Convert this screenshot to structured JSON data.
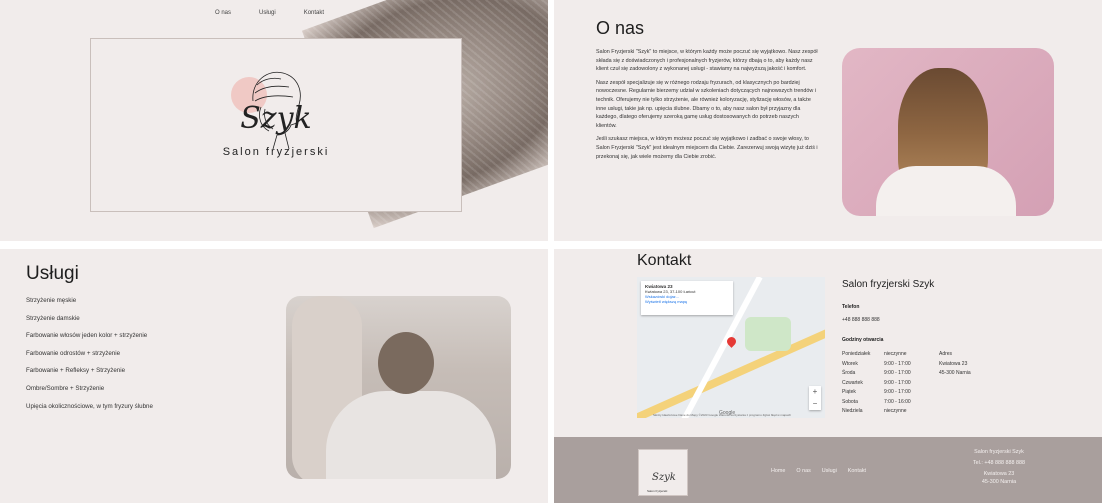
{
  "nav": {
    "items": [
      "O nas",
      "Usługi",
      "Kontakt"
    ]
  },
  "logo": {
    "word": "Szyk",
    "subtitle": "Salon fryzjerski"
  },
  "about": {
    "title": "O nas",
    "paragraphs": [
      "Salon Fryzjerski \"Szyk\" to miejsce, w którym każdy może poczuć się wyjątkowo. Nasz zespół składa się z doświadczonych i profesjonalnych fryzjerów, którzy dbają o to, aby każdy nasz klient czuł się zadowolony z wykonanej usługi - stawiamy na najwyższą jakość i komfort.",
      "Nasz zespół specjalizuje się w różnego rodzaju fryzurach, od klasycznych po bardziej nowoczesne. Regularnie bierzemy udział w szkoleniach dotyczących najnowszych trendów i technik. Oferujemy nie tylko strzyżenie, ale również koloryzację, stylizację włosów, a także inne usługi, takie jak np. upięcia ślubne. Dbamy o to, aby nasz salon był przyjazny dla każdego, dlatego oferujemy szeroką gamę usług dostosowanych do potrzeb naszych klientów.",
      "Jeśli szukasz miejsca, w którym możesz poczuć się wyjątkowo i zadbać o swoje włosy, to Salon Fryzjerski \"Szyk\" jest idealnym miejscem dla Ciebie. Zarezerwuj swoją wizytę już dziś i przekonaj się, jak wiele możemy dla Ciebie zrobić."
    ]
  },
  "services": {
    "title": "Usługi",
    "items": [
      "Strzyżenie męskie",
      "Strzyżenie damskie",
      "Farbowanie włosów jeden kolor + strzyżenie",
      "Farbowanie odrostów + strzyżenie",
      "Farbowanie + Refleksy + Strzyżenie",
      "Ombre/Sombre + Strzyżenie",
      "Upięcia okolicznościowe, w tym fryzury ślubne"
    ]
  },
  "contact": {
    "title": "Kontakt",
    "map": {
      "place": "Kwiatowa 23",
      "address": "Kwiatowa 23, 37-100 Łańcut",
      "directions": "Wskazówki dojaz...",
      "larger_map": "Wyświetl większą mapę",
      "google": "Google",
      "footer": "Skróty klawiszowe   Dane do Mapy ©2023 Google   Warunki korzystania z programu   Zgłoś błąd w mapach",
      "zoom_in": "+",
      "zoom_out": "−"
    },
    "salon_name": "Salon fryzjerski Szyk",
    "phone_label": "Telefon",
    "phone": "+48 888 888 888",
    "hours_label": "Godziny otwarcia",
    "hours": [
      {
        "day": "Poniedziałek",
        "time": "nieczynne",
        "col": "Adres"
      },
      {
        "day": "Wtorek",
        "time": "9:00 - 17:00",
        "col": "Kwiatowa 23"
      },
      {
        "day": "Środa",
        "time": "9:00 - 17:00",
        "col": "45-300 Narnia"
      },
      {
        "day": "Czwartek",
        "time": "9:00 - 17:00",
        "col": ""
      },
      {
        "day": "Piątek",
        "time": "9:00 - 17:00",
        "col": ""
      },
      {
        "day": "Sobota",
        "time": "7:00 - 16:00",
        "col": ""
      },
      {
        "day": "Niedziela",
        "time": "nieczynne",
        "col": ""
      }
    ]
  },
  "footer": {
    "logo_word": "Szyk",
    "logo_sub": "Salon fryzjerski",
    "nav": [
      "Home",
      "O nas",
      "Usługi",
      "Kontakt"
    ],
    "salon": "Salon fryzjerski Szyk",
    "phone": "Tel.: +48 888 888 888",
    "street": "Kwiatowa 23",
    "city": "45-300 Narnia"
  }
}
